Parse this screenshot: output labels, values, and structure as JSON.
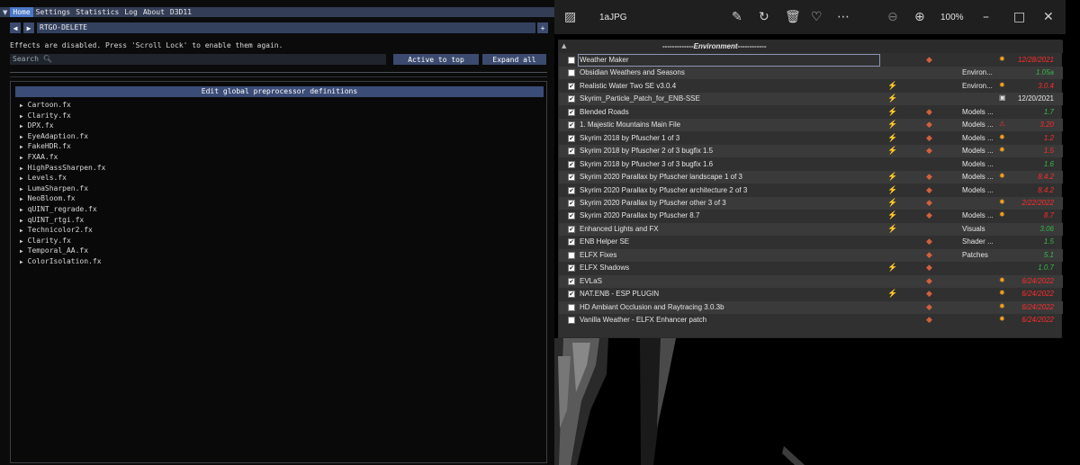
{
  "reshade": {
    "menu": [
      "Home",
      "Settings",
      "Statistics",
      "Log",
      "About",
      "D3D11"
    ],
    "active_menu": "Home",
    "preset": "RTGO-DELETE",
    "prev_label": "◀",
    "next_label": "▶",
    "add_label": "+",
    "effects_message": "Effects are disabled. Press 'Scroll Lock' to enable them again.",
    "search_placeholder": "Search",
    "active_to_top": "Active to top",
    "expand_all": "Expand all",
    "preprocessor": "Edit global preprocessor definitions",
    "effects": [
      "Cartoon.fx",
      "Clarity.fx",
      "DPX.fx",
      "EyeAdaption.fx",
      "FakeHDR.fx",
      "FXAA.fx",
      "HighPassSharpen.fx",
      "Levels.fx",
      "LumaSharpen.fx",
      "NeoBloom.fx",
      "qUINT_regrade.fx",
      "qUINT_rtgi.fx",
      "Technicolor2.fx",
      "Clarity.fx",
      "Temporal_AA.fx",
      "ColorIsolation.fx"
    ]
  },
  "photos": {
    "file_title": "1aJPG",
    "zoom": "100%",
    "section": "-------------Environment------------",
    "colors": {
      "version_red": "#ff2b2b",
      "version_green": "#39b54a",
      "version_white": "#e6e6e6"
    },
    "mods": [
      {
        "name": "Weather Maker",
        "checked": false,
        "f1": "",
        "f2": "◆",
        "cat": "",
        "cf": "✹",
        "ver": "12/28/2021",
        "vc": "red"
      },
      {
        "name": "Obsidian Weathers and Seasons",
        "checked": false,
        "f1": "",
        "f2": "",
        "cat": "Environ...",
        "cf": "",
        "ver": "1.05a",
        "vc": "green"
      },
      {
        "name": "Realistic Water Two SE v3.0.4",
        "checked": true,
        "f1": "⚡",
        "f2": "",
        "cat": "Environ...",
        "cf": "✹",
        "ver": "3.0.4",
        "vc": "red"
      },
      {
        "name": "Skyrim_Particle_Patch_for_ENB-SSE",
        "checked": true,
        "f1": "⚡",
        "f2": "",
        "cat": "",
        "cf": "▣",
        "ver": "12/20/2021",
        "vc": "white"
      },
      {
        "name": "Blended Roads",
        "checked": true,
        "f1": "⚡",
        "f2": "◆",
        "cat": "Models ...",
        "cf": "",
        "ver": "1.7",
        "vc": "green"
      },
      {
        "name": "1. Majestic Mountains Main File",
        "checked": true,
        "f1": "⚡",
        "f2": "◆",
        "cat": "Models ...",
        "cf": "⚠",
        "ver": "3.20",
        "vc": "red"
      },
      {
        "name": "Skyrim 2018 by Pfuscher 1 of 3",
        "checked": true,
        "f1": "⚡",
        "f2": "◆",
        "cat": "Models ...",
        "cf": "✹",
        "ver": "1.2",
        "vc": "red"
      },
      {
        "name": "Skyrim 2018 by Pfuscher 2 of 3 bugfix 1.5",
        "checked": true,
        "f1": "⚡",
        "f2": "◆",
        "cat": "Models ...",
        "cf": "✹",
        "ver": "1.5",
        "vc": "red"
      },
      {
        "name": "Skyrim 2018 by Pfuscher 3 of 3 bugfix 1.6",
        "checked": true,
        "f1": "",
        "f2": "",
        "cat": "Models ...",
        "cf": "",
        "ver": "1.6",
        "vc": "green"
      },
      {
        "name": "Skyrim 2020 Parallax by Pfuscher landscape 1 of 3",
        "checked": true,
        "f1": "⚡",
        "f2": "◆",
        "cat": "Models ...",
        "cf": "✹",
        "ver": "8.4.2",
        "vc": "red"
      },
      {
        "name": "Skyrim 2020 Parallax by Pfuscher architecture 2 of 3",
        "checked": true,
        "f1": "⚡",
        "f2": "◆",
        "cat": "Models ...",
        "cf": "",
        "ver": "8.4.2",
        "vc": "red"
      },
      {
        "name": "Skyrim 2020 Parallax by Pfuscher other 3 of 3",
        "checked": true,
        "f1": "⚡",
        "f2": "◆",
        "cat": "",
        "cf": "✹",
        "ver": "2/22/2022",
        "vc": "red"
      },
      {
        "name": "Skyrim 2020 Parallax by Pfuscher 8.7",
        "checked": true,
        "f1": "⚡",
        "f2": "◆",
        "cat": "Models ...",
        "cf": "✹",
        "ver": "8.7",
        "vc": "red"
      },
      {
        "name": "Enhanced Lights and FX",
        "checked": true,
        "f1": "⚡",
        "f2": "",
        "cat": "Visuals",
        "cf": "",
        "ver": "3.06",
        "vc": "green"
      },
      {
        "name": "ENB Helper SE",
        "checked": true,
        "f1": "",
        "f2": "◆",
        "cat": "Shader ...",
        "cf": "",
        "ver": "1.5",
        "vc": "green"
      },
      {
        "name": "ELFX Fixes",
        "checked": false,
        "f1": "",
        "f2": "◆",
        "cat": "Patches",
        "cf": "",
        "ver": "5.1",
        "vc": "green"
      },
      {
        "name": "ELFX Shadows",
        "checked": true,
        "f1": "⚡",
        "f2": "◆",
        "cat": "",
        "cf": "",
        "ver": "1.0.7",
        "vc": "green"
      },
      {
        "name": "EVLaS",
        "checked": true,
        "f1": "",
        "f2": "◆",
        "cat": "",
        "cf": "✹",
        "ver": "6/24/2022",
        "vc": "red"
      },
      {
        "name": "NAT.ENB - ESP PLUGIN",
        "checked": true,
        "f1": "⚡",
        "f2": "◆",
        "cat": "",
        "cf": "✹",
        "ver": "6/24/2022",
        "vc": "red"
      },
      {
        "name": "HD Ambiant Occlusion and Raytracing 3.0.3b",
        "checked": false,
        "f1": "",
        "f2": "◆",
        "cat": "",
        "cf": "✹",
        "ver": "6/24/2022",
        "vc": "red"
      },
      {
        "name": "Vanilla Weather - ELFX Enhancer patch",
        "checked": false,
        "f1": "",
        "f2": "◆",
        "cat": "",
        "cf": "✹",
        "ver": "6/24/2022",
        "vc": "red"
      }
    ]
  }
}
